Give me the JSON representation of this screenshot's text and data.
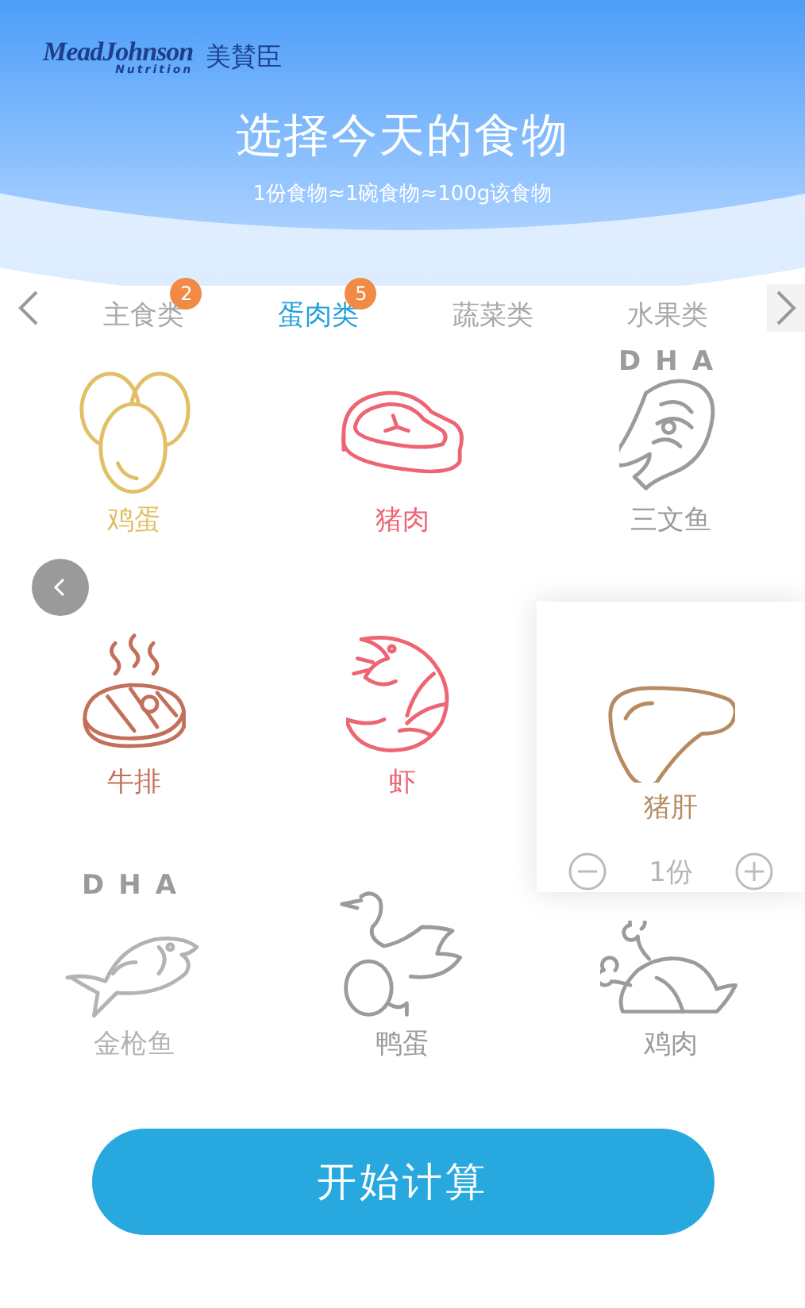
{
  "brand": {
    "wordmark": "MeadJohnson",
    "tagline": "Nutrition",
    "name": "美賛臣"
  },
  "title": "选择今天的食物",
  "subtitle": "1份食物≈1碗食物≈100g该食物",
  "tabs": [
    {
      "label": "主食类",
      "selected": false,
      "badge": "2"
    },
    {
      "label": "蛋肉类",
      "selected": true,
      "badge": "5"
    },
    {
      "label": "蔬菜类",
      "selected": false
    },
    {
      "label": "水果类",
      "selected": false
    }
  ],
  "foods": [
    {
      "kind": "egg",
      "label": "鸡蛋",
      "color": "#e2bf66"
    },
    {
      "kind": "pork",
      "label": "猪肉",
      "color": "#ee6472"
    },
    {
      "kind": "salmon",
      "label": "三文鱼",
      "color": "#9b9b9b",
      "tag": "DHA"
    },
    {
      "kind": "steak",
      "label": "牛排",
      "color": "#c3705a"
    },
    {
      "kind": "shrimp",
      "label": "虾",
      "color": "#ee6472"
    },
    {
      "kind": "liver",
      "label": "猪肝",
      "color": "#b68b62",
      "amount": "1份"
    },
    {
      "kind": "tuna",
      "label": "金枪鱼",
      "color": "#b3b3b3",
      "tag": "DHA"
    },
    {
      "kind": "duck",
      "label": "鸭蛋",
      "color": "#9b9b9b"
    },
    {
      "kind": "chicken",
      "label": "鸡肉",
      "color": "#9b9b9b"
    }
  ],
  "button": "开始计算"
}
